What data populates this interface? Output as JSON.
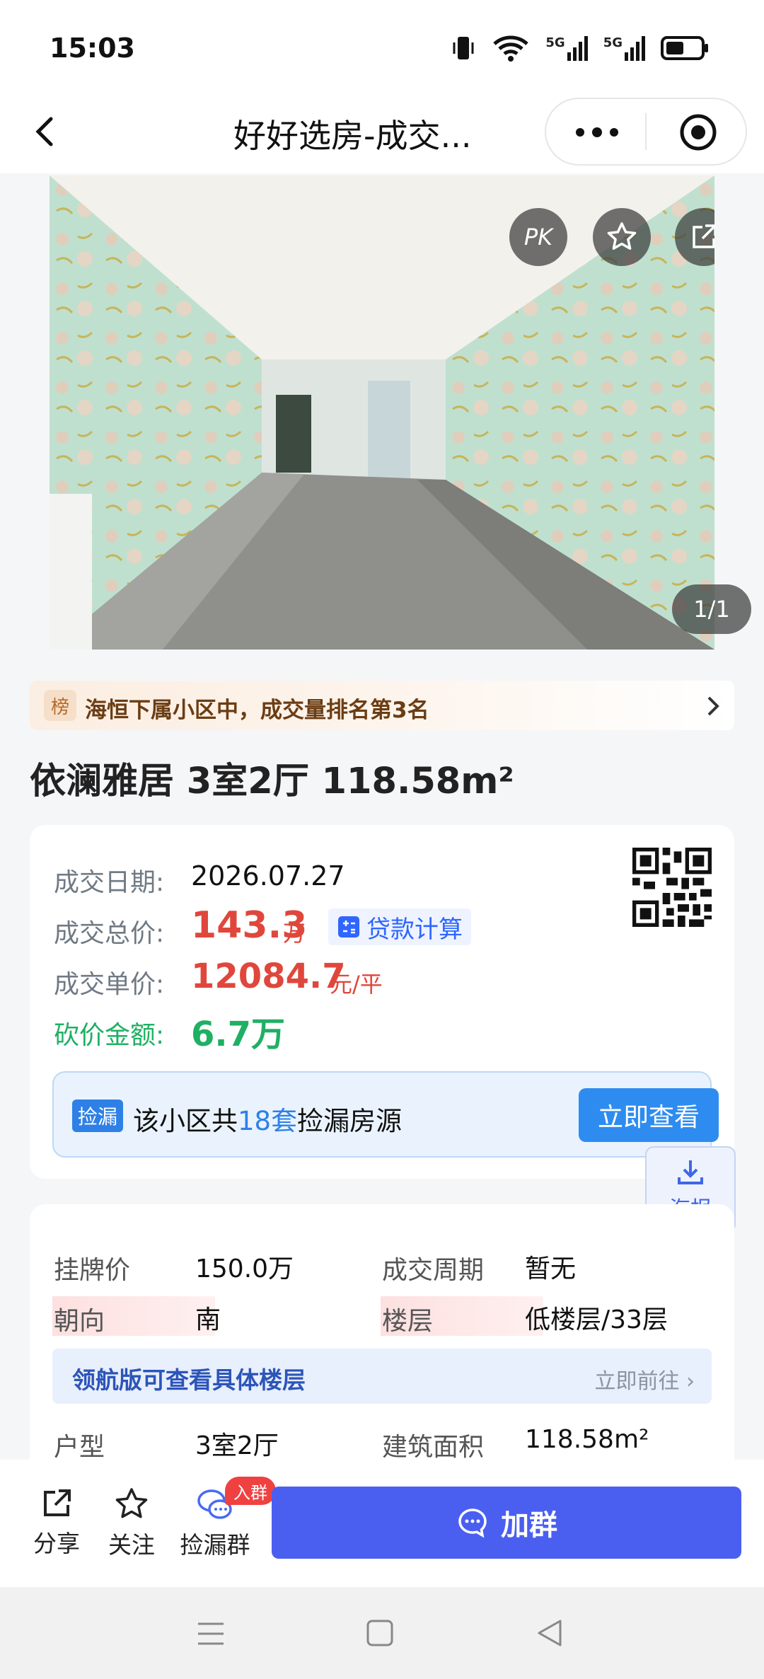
{
  "status_bar": {
    "time": "15:03",
    "signal_labels": [
      "5G",
      "5G"
    ]
  },
  "nav": {
    "title": "好好选房-成交..."
  },
  "gallery": {
    "pk_label": "PK",
    "counter": "1/1"
  },
  "ranking": {
    "tag": "榜",
    "text": "海恒下属小区中，成交量排名第3名"
  },
  "house_title": "依澜雅居 3室2厅 118.58m²",
  "deal": {
    "date_label": "成交日期:",
    "date_value": "2026.07.27",
    "total_label": "成交总价:",
    "total_value": "143.3",
    "total_unit": "万",
    "loan_label": "贷款计算",
    "unit_label": "成交单价:",
    "unit_value": "12084.7",
    "unit_unit": "元/平",
    "cut_label": "砍价金额:",
    "cut_value": "6.7万"
  },
  "leak": {
    "tag": "捡漏",
    "prefix": "该小区共",
    "count": "18套",
    "suffix": "捡漏房源",
    "button": "立即查看"
  },
  "poster": {
    "label": "海报"
  },
  "info": {
    "rows": [
      {
        "k1": "挂牌价",
        "v1": "150.0万",
        "k2": "成交周期",
        "v2": "暂无"
      },
      {
        "k1": "朝向",
        "v1": "南",
        "k2": "楼层",
        "v2": "低楼层/33层"
      },
      {
        "k1": "户型",
        "v1": "3室2厅",
        "k2": "建筑面积",
        "v2": "118.58m²"
      }
    ],
    "promo_text": "领航版可查看具体楼层",
    "promo_link": "立即前往"
  },
  "bottom_bar": {
    "share": "分享",
    "follow": "关注",
    "group": "捡漏群",
    "group_badge": "入群",
    "join": "加群"
  },
  "colors": {
    "accent": "#4a5ff0",
    "price_red": "#e0473c",
    "cut_green": "#1fb064",
    "link_blue": "#2e80e6"
  }
}
